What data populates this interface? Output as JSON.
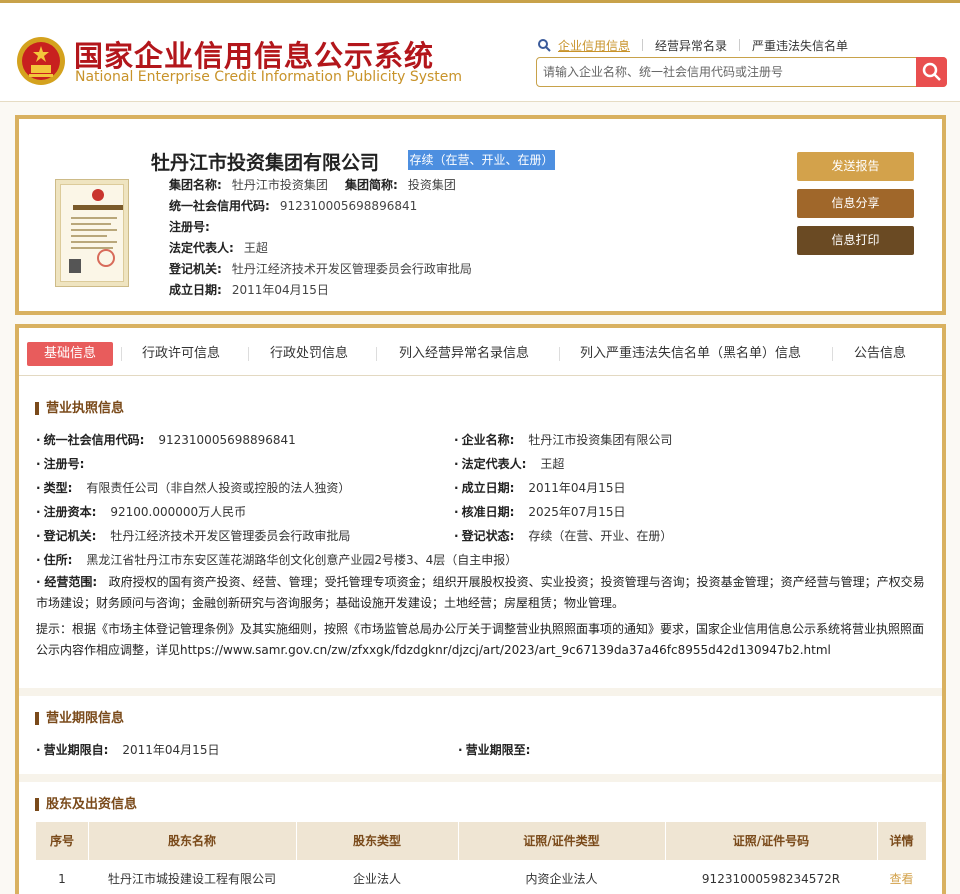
{
  "site": {
    "title": "国家企业信用信息公示系统",
    "subtitle": "National Enterprise Credit Information Publicity System"
  },
  "nav": {
    "items": [
      "企业信用信息",
      "经营异常名录",
      "严重违法失信名单"
    ]
  },
  "search": {
    "placeholder": "请输入企业名称、统一社会信用代码或注册号"
  },
  "company": {
    "name": "牡丹江市投资集团有限公司",
    "status": "存续（在营、开业、在册）",
    "group_name_label": "集团名称:",
    "group_name": "牡丹江市投资集团",
    "group_short_label": "集团简称:",
    "group_short": "投资集团",
    "credit_code_label": "统一社会信用代码:",
    "credit_code": "912310005698896841",
    "reg_no_label": "注册号:",
    "legal_rep_label": "法定代表人:",
    "legal_rep": "王超",
    "authority_label": "登记机关:",
    "authority": "牡丹江经济技术开发区管理委员会行政审批局",
    "founded_label": "成立日期:",
    "founded": "2011年04月15日"
  },
  "actions": {
    "report": "发送报告",
    "share": "信息分享",
    "print": "信息打印"
  },
  "tabs": [
    "基础信息",
    "行政许可信息",
    "行政处罚信息",
    "列入经营异常名录信息",
    "列入严重违法失信名单（黑名单）信息",
    "公告信息"
  ],
  "license": {
    "section_title": "营业执照信息",
    "credit_code_label": "统一社会信用代码:",
    "credit_code": "912310005698896841",
    "name_label": "企业名称:",
    "name": "牡丹江市投资集团有限公司",
    "reg_no_label": "注册号:",
    "legal_rep_label": "法定代表人:",
    "legal_rep": "王超",
    "type_label": "类型:",
    "type": "有限责任公司（非自然人投资或控股的法人独资）",
    "founded_label": "成立日期:",
    "founded": "2011年04月15日",
    "capital_label": "注册资本:",
    "capital": "92100.000000万人民币",
    "approved_label": "核准日期:",
    "approved": "2025年07月15日",
    "authority_label": "登记机关:",
    "authority": "牡丹江经济技术开发区管理委员会行政审批局",
    "reg_status_label": "登记状态:",
    "reg_status": "存续（在营、开业、在册）",
    "address_label": "住所:",
    "address": "黑龙江省牡丹江市东安区莲花湖路华创文化创意产业园2号楼3、4层（自主申报）",
    "scope_label": "经营范围:",
    "scope": "政府授权的国有资产投资、经营、管理；受托管理专项资金；组织开展股权投资、实业投资；投资管理与咨询；投资基金管理；资产经营与管理；产权交易市场建设；财务顾问与咨询；金融创新研究与咨询服务；基础设施开发建设；土地经营；房屋租赁；物业管理。",
    "notice": "提示：根据《市场主体登记管理条例》及其实施细则，按照《市场监管总局办公厅关于调整营业执照照面事项的通知》要求，国家企业信用信息公示系统将营业执照照面公示内容作相应调整，详见https://www.samr.gov.cn/zw/zfxxgk/fdzdgknr/djzcj/art/2023/art_9c67139da37a46fc8955d42d130947b2.html"
  },
  "term": {
    "section_title": "营业期限信息",
    "from_label": "营业期限自:",
    "from": "2011年04月15日",
    "to_label": "营业期限至:"
  },
  "shareholders": {
    "section_title": "股东及出资信息",
    "columns": [
      "序号",
      "股东名称",
      "股东类型",
      "证照/证件类型",
      "证照/证件号码",
      "详情"
    ],
    "rows": [
      [
        "1",
        "牡丹江市城投建设工程有限公司",
        "企业法人",
        "内资企业法人",
        "91231000598234572R",
        "查看"
      ]
    ]
  }
}
